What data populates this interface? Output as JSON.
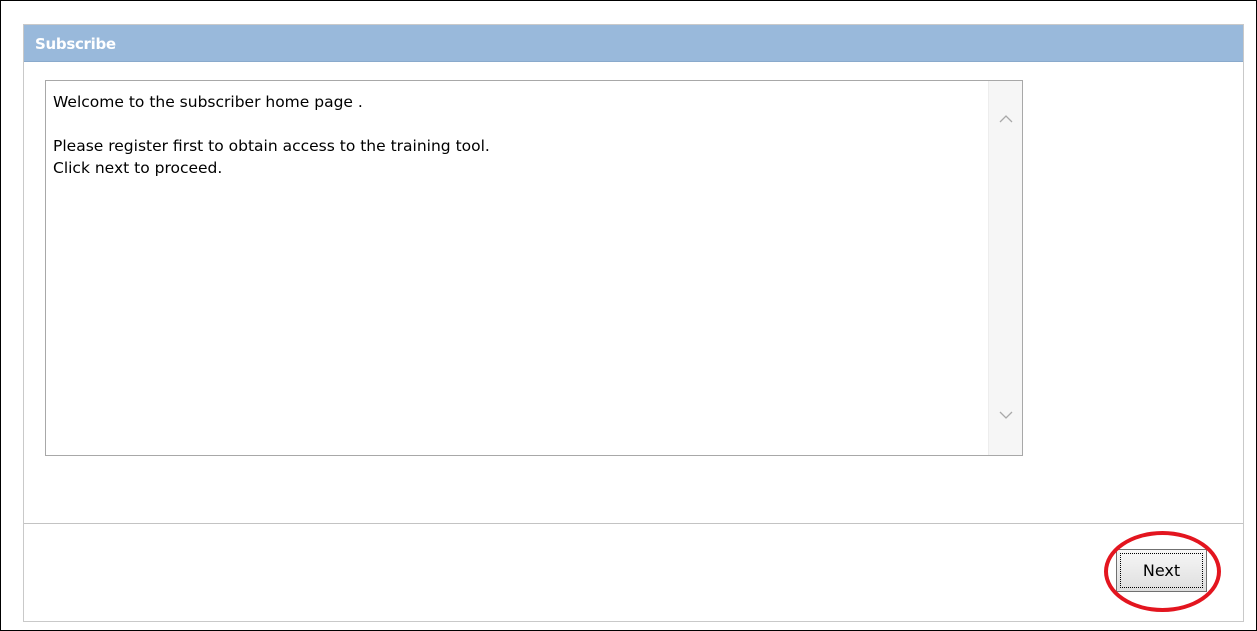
{
  "panel": {
    "title": "Subscribe"
  },
  "message": {
    "text": "Welcome to the subscriber home page .\n\nPlease register first to obtain access to the training tool.\nClick next to proceed."
  },
  "actions": {
    "next_label": "Next"
  },
  "colors": {
    "header_bg": "#99b9db",
    "highlight": "#e3151f"
  },
  "icons": {
    "scroll_up": "chevron-up-icon",
    "scroll_down": "chevron-down-icon"
  }
}
